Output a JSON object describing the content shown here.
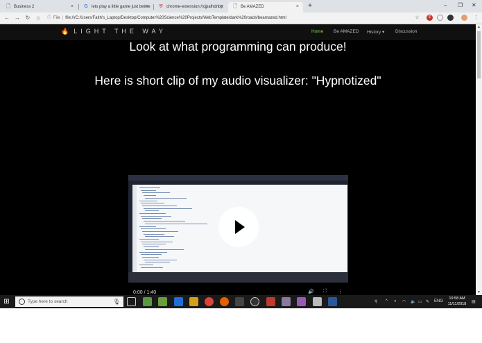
{
  "browser": {
    "tabs": [
      {
        "label": "Business 2",
        "icon": "document-icon"
      },
      {
        "label": "lets play a little game just betwe",
        "icon": "google-icon"
      },
      {
        "label": "chrome-extension://cjpalhdnbp",
        "icon": "shield-icon"
      },
      {
        "label": "Be AMAZED",
        "icon": "document-icon",
        "active": true
      }
    ],
    "close_glyph": "×",
    "new_tab_glyph": "+",
    "url_prefix": "File",
    "url": "file:///C:/Users/Faith's_Laptop/Desktop/Computer%20Science%20Projects/WebTemplate/dark%20roads/beamazed.html"
  },
  "site": {
    "brand": "LIGHT THE WAY",
    "nav": [
      {
        "label": "Home",
        "active": true
      },
      {
        "label": "Be AMAZED"
      },
      {
        "label": "History ▾"
      },
      {
        "label": "Discussion"
      }
    ],
    "headline": "Look at what programming can produce!",
    "subheadline": "Here is short clip of my audio visualizer: \"Hypnotized\"",
    "video": {
      "time": "0:00 / 1:40"
    }
  },
  "taskbar": {
    "search_placeholder": "Type here to search",
    "language": "ENG",
    "time": "10:58 AM",
    "date": "11/11/2018"
  },
  "colors": {
    "page_bg": "#000000",
    "nav_active": "#7fd850",
    "navbar_bg": "#101010"
  }
}
